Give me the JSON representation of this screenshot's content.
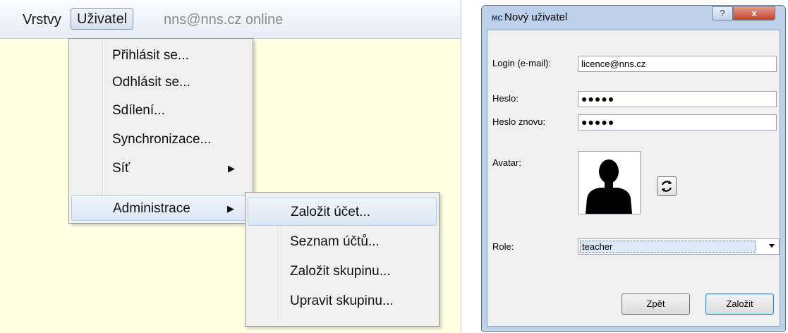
{
  "menubar": {
    "items": [
      {
        "label": "Vrstvy"
      },
      {
        "label": "Uživatel"
      }
    ],
    "status": "nns@nns.cz online"
  },
  "user_menu": {
    "items": [
      {
        "label": "Přihlásit se..."
      },
      {
        "label": "Odhlásit se..."
      },
      {
        "label": "Sdílení..."
      },
      {
        "label": "Synchronizace..."
      },
      {
        "label": "Síť",
        "arrow": "▶"
      },
      {
        "label": "Administrace",
        "arrow": "▶"
      }
    ]
  },
  "admin_submenu": {
    "items": [
      {
        "label": "Založit účet..."
      },
      {
        "label": "Seznam účtů..."
      },
      {
        "label": "Založit skupinu..."
      },
      {
        "label": "Upravit skupinu..."
      }
    ]
  },
  "dialog": {
    "icon_text": "MC",
    "title": "Nový uživatel",
    "help_glyph": "?",
    "close_glyph": "x",
    "login_label": "Login (e-mail):",
    "login_value": "licence@nns.cz",
    "password_label": "Heslo:",
    "password_value": "●●●●●",
    "password_again_label": "Heslo znovu:",
    "password_again_value": "●●●●●",
    "avatar_label": "Avatar:",
    "role_label": "Role:",
    "role_value": "teacher",
    "back_button": "Zpět",
    "create_button": "Založit"
  },
  "colors": {
    "app_background": "#ffffe3",
    "menu_background": "#f0f0f0",
    "highlight": "#dbe6f4",
    "dialog_frame": "#bdd2ea",
    "close_red": "#c2432e"
  }
}
